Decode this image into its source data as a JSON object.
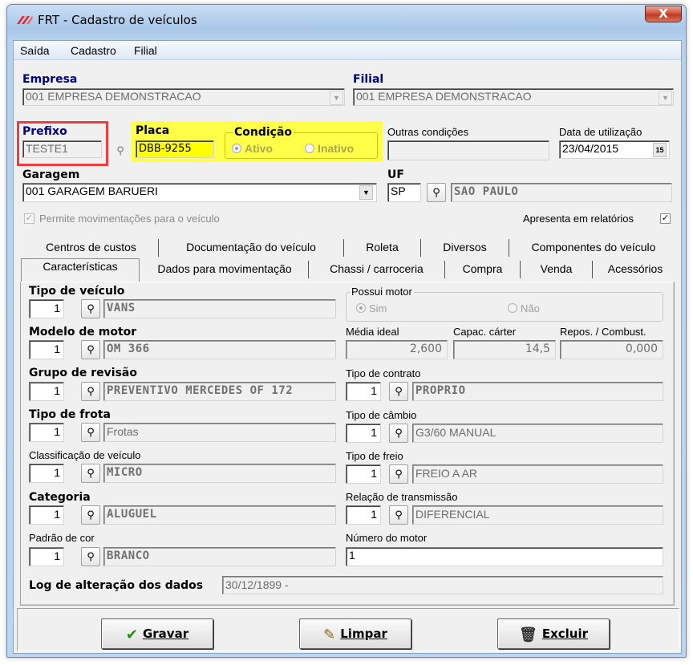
{
  "window": {
    "title": "FRT - Cadastro de veículos",
    "close_label": "X"
  },
  "menu": {
    "items": [
      "Saída",
      "Cadastro",
      "Filial"
    ]
  },
  "header": {
    "empresa_label": "Empresa",
    "empresa_value": "001 EMPRESA DEMONSTRACAO",
    "filial_label": "Filial",
    "filial_value": "001 EMPRESA DEMONSTRACAO",
    "prefixo_label": "Prefixo",
    "prefixo_value": "TESTE1",
    "placa_label": "Placa",
    "placa_value": "DBB-9255",
    "condicao_label": "Condição",
    "condicao_ativo": "Ativo",
    "condicao_inativo": "Inativo",
    "outras_label": "Outras condições",
    "outras_value": "",
    "data_label": "Data de utilização",
    "data_value": "23/04/2015",
    "garagem_label": "Garagem",
    "garagem_value": "001 GARAGEM BARUERI",
    "uf_label": "UF",
    "uf_code": "SP",
    "uf_name": "SAO PAULO",
    "permite_label": "Permite movimentações para o veículo",
    "apresenta_label": "Apresenta em relatórios"
  },
  "tabs": {
    "row1": [
      "Centros de custos",
      "Documentação do veículo",
      "Roleta",
      "Diversos",
      "Componentes do veículo"
    ],
    "row2": [
      "Características",
      "Dados para movimentação",
      "Chassi / carroceria",
      "Compra",
      "Venda",
      "Acessórios"
    ]
  },
  "panel": {
    "tipo_veiculo": {
      "label": "Tipo de veículo",
      "code": "1",
      "desc": "VANS"
    },
    "possui_motor": {
      "label": "Possui motor",
      "sim": "Sim",
      "nao": "Não"
    },
    "modelo_motor": {
      "label": "Modelo de motor",
      "code": "1",
      "desc": "OM 366"
    },
    "media_ideal": {
      "label": "Média ideal",
      "value": "2,600"
    },
    "capac_carter": {
      "label": "Capac. cárter",
      "value": "14,5"
    },
    "repos_combust": {
      "label": "Repos. / Combust.",
      "value": "0,000"
    },
    "grupo_revisao": {
      "label": "Grupo de revisão",
      "code": "1",
      "desc": "PREVENTIVO MERCEDES OF 172"
    },
    "tipo_contrato": {
      "label": "Tipo de contrato",
      "code": "1",
      "desc": "PROPRIO"
    },
    "tipo_frota": {
      "label": "Tipo de frota",
      "code": "1",
      "desc": "Frotas"
    },
    "tipo_cambio": {
      "label": "Tipo de câmbio",
      "code": "1",
      "desc": "G3/60  MANUAL"
    },
    "classificacao": {
      "label": "Classificação de veículo",
      "code": "1",
      "desc": "MICRO"
    },
    "tipo_freio": {
      "label": "Tipo de freio",
      "code": "1",
      "desc": "FREIO A AR"
    },
    "categoria": {
      "label": "Categoria",
      "code": "1",
      "desc": "ALUGUEL"
    },
    "relacao": {
      "label": "Relação de transmissão",
      "code": "1",
      "desc": "DIFERENCIAL"
    },
    "padrao_cor": {
      "label": "Padrão de cor",
      "code": "1",
      "desc": "BRANCO"
    },
    "numero_motor": {
      "label": "Número do motor",
      "value": "1"
    },
    "log": {
      "label": "Log de alteração dos dados",
      "value": "30/12/1899 -"
    }
  },
  "actions": {
    "gravar": "Gravar",
    "limpar": "Limpar",
    "excluir": "Excluir"
  }
}
